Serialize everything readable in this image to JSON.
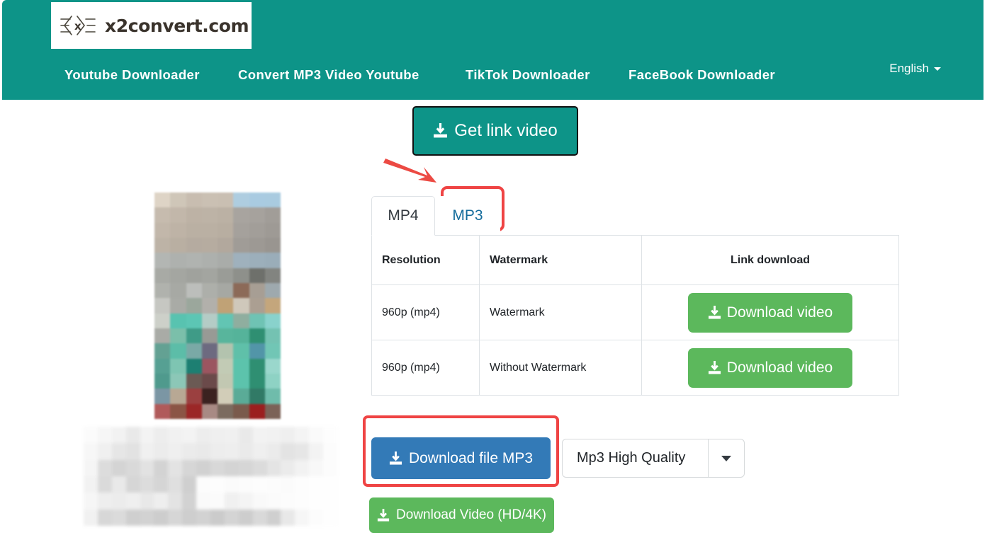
{
  "site": {
    "logo_text": "x2convert.com",
    "logo_icon": "x-brackets-logo-icon"
  },
  "nav": {
    "items": [
      {
        "label": "Youtube Downloader"
      },
      {
        "label": "Convert MP3 Video Youtube"
      },
      {
        "label": "TikTok Downloader"
      },
      {
        "label": "FaceBook Downloader"
      }
    ],
    "language": {
      "label": "English",
      "icon": "chevron-down-icon"
    }
  },
  "actions": {
    "get_link_label": "Get link video",
    "get_link_icon": "download-icon"
  },
  "tabs": [
    {
      "label": "MP4",
      "active": true
    },
    {
      "label": "MP3",
      "active": false
    }
  ],
  "table": {
    "headers": [
      "Resolution",
      "Watermark",
      "Link download"
    ],
    "rows": [
      {
        "resolution": "960p (mp4)",
        "watermark": "Watermark",
        "button_label": "Download video",
        "button_icon": "download-icon"
      },
      {
        "resolution": "960p (mp4)",
        "watermark": "Without Watermark",
        "button_label": "Download video",
        "button_icon": "download-icon"
      }
    ]
  },
  "footer_actions": {
    "mp3_button_label": "Download file MP3",
    "mp3_button_icon": "download-icon",
    "quality_selected": "Mp3 High Quality",
    "quality_caret_icon": "caret-down-icon",
    "hd_button_label": "Download Video (HD/4K)",
    "hd_button_icon": "download-icon"
  },
  "annotations": {
    "arrow": "red-arrow-pointing-to-mp3-tab",
    "box_mp3_tab": "red-highlight-box-mp3-tab",
    "box_mp3_download": "red-highlight-box-download-file-mp3"
  },
  "thumbnail": {
    "description": "blurred-video-thumbnail",
    "caption": "blurred-video-title-text"
  },
  "colors": {
    "header_teal": "#0d9488",
    "button_green": "#5cb85c",
    "button_blue": "#337ab7",
    "annotation_red": "#ef4444",
    "tab_link_blue": "#146c9c"
  },
  "thumb_pixels": [
    "#ded4c6",
    "#cfc6b8",
    "#c8bdb0",
    "#cac0b3",
    "#c9bfb2",
    "#aecde0",
    "#a9cbe1",
    "#a9cbe0",
    "#c6bbae",
    "#c2b7aa",
    "#bdb2a5",
    "#bdb3a6",
    "#bbb1a4",
    "#a8a49f",
    "#a6a29d",
    "#a19d98",
    "#c2b7aa",
    "#beb3a6",
    "#bab0a3",
    "#bab0a3",
    "#b8aea1",
    "#a5a19c",
    "#a29e99",
    "#9e9a95",
    "#bdb3a6",
    "#b9afa2",
    "#b5aba0",
    "#b6aca0",
    "#b2a89d",
    "#a09c97",
    "#9d9994",
    "#999590",
    "#b3b6b3",
    "#aeb1ae",
    "#b0b3b0",
    "#adb0ad",
    "#a9aca9",
    "#9fb1bd",
    "#9cafbb",
    "#9aadb9",
    "#a8aaa5",
    "#a4a6a1",
    "#a0a29d",
    "#a3a5a0",
    "#9a9c97",
    "#8e908b",
    "#6e706b",
    "#828480",
    "#b0b2ad",
    "#a7a9a4",
    "#bcbebb",
    "#adafaa",
    "#a6a8a3",
    "#8c6a58",
    "#a79e94",
    "#9ea9ae",
    "#c6c7c2",
    "#a9aba6",
    "#9ba79c",
    "#b2b0ab",
    "#c0a276",
    "#cfc8bb",
    "#ab9f92",
    "#c4a67c",
    "#cdd0c9",
    "#58c3b0",
    "#5cc6b4",
    "#b4ccc6",
    "#62c5b3",
    "#8fae9f",
    "#6fc3b4",
    "#89d2cc",
    "#a9aba6",
    "#7bbfaa",
    "#3f9b87",
    "#989a95",
    "#58b59c",
    "#55b39a",
    "#2f8f72",
    "#74c2b2",
    "#63a193",
    "#5cbda8",
    "#7aa9a6",
    "#6d6a80",
    "#b3c3ae",
    "#5fc0a9",
    "#5295a8",
    "#71c6b5",
    "#56a093",
    "#7ec5b2",
    "#1d7f72",
    "#9b5560",
    "#c2cbb5",
    "#5cc3ac",
    "#2f8f72",
    "#9ad7cc",
    "#4f9a8d",
    "#8cc7b7",
    "#6b5a54",
    "#6b4a4a",
    "#c2c8b2",
    "#5cc3ac",
    "#2f8f72",
    "#8ed2c4",
    "#7b96a4",
    "#b8a894",
    "#9b4040",
    "#3b2220",
    "#d2cdb8",
    "#5aab97",
    "#317a66",
    "#6fbcab",
    "#b05a5a",
    "#8b5545",
    "#9b2727",
    "#a88a84",
    "#7b6b5f",
    "#7a5a4c",
    "#9b1f1f",
    "#7b6257"
  ],
  "blur_text_pixels": [
    "#fbfbfb",
    "#f6f6f6",
    "#f2f2f2",
    "#e9e9e9",
    "#f3f3f3",
    "#ededed",
    "#f1f1f1",
    "#f3f3f3",
    "#ededed",
    "#efefef",
    "#f0f0f0",
    "#e9e9e9",
    "#f2f2f2",
    "#f1f1f1",
    "#efefef",
    "#f4f4f4",
    "#fafafa",
    "#fdfdfd",
    "#f7f7f7",
    "#f0f0f0",
    "#e6e6e6",
    "#e2e2e2",
    "#f0f0f0",
    "#ececec",
    "#efefef",
    "#ebebeb",
    "#e9e9e9",
    "#ededed",
    "#eeeeee",
    "#eaeaea",
    "#efefef",
    "#ebebeb",
    "#e3e3e3",
    "#e6e6e6",
    "#f3f3f3",
    "#fcfcfc",
    "#f5f5f5",
    "#dcdcdc",
    "#d4d4d4",
    "#d9d9d9",
    "#e2e2e2",
    "#d3d3d3",
    "#e3e3e3",
    "#d6d6d6",
    "#d1d1d1",
    "#d8d8d8",
    "#d4d4d4",
    "#d6d6d6",
    "#dbdbdb",
    "#e4e4e4",
    "#ebebeb",
    "#f2f2f2",
    "#f8f8f8",
    "#fcfcfc",
    "#f2f2f2",
    "#dadada",
    "#e9e9e9",
    "#d6d6d6",
    "#dcdcdc",
    "#d5d5d5",
    "#dfdfdf",
    "#cfcfcf",
    "#fcfcfc",
    "#fdfdfd",
    "#fbfbfb",
    "#fcfcfc",
    "#fdfdfd",
    "#fcfcfc",
    "#fbfbfb",
    "#fdfdfd",
    "#fefefe",
    "#fefefe",
    "#f6f6f6",
    "#eeeeee",
    "#ececec",
    "#efefef",
    "#e8e8e8",
    "#eeeeee",
    "#e3e3e3",
    "#d2d2d2",
    "#fafafa",
    "#fbfbfb",
    "#f0f0f0",
    "#f4f4f4",
    "#f9f9f9",
    "#fbfbfb",
    "#fcfcfc",
    "#fdfdfd",
    "#fefefe",
    "#fefefe",
    "#f1f1f1",
    "#d7d7d7",
    "#dbdbdb",
    "#cfcfcf",
    "#d2d2d2",
    "#cdcdcd",
    "#d6d6d6",
    "#cecece",
    "#d2d2d2",
    "#cbcbcb",
    "#d4d4d4",
    "#cdcdcd",
    "#d9d9d9",
    "#cfcfcf",
    "#e8e8e8",
    "#f6f6f6",
    "#fcfcfc",
    "#fefefe"
  ]
}
